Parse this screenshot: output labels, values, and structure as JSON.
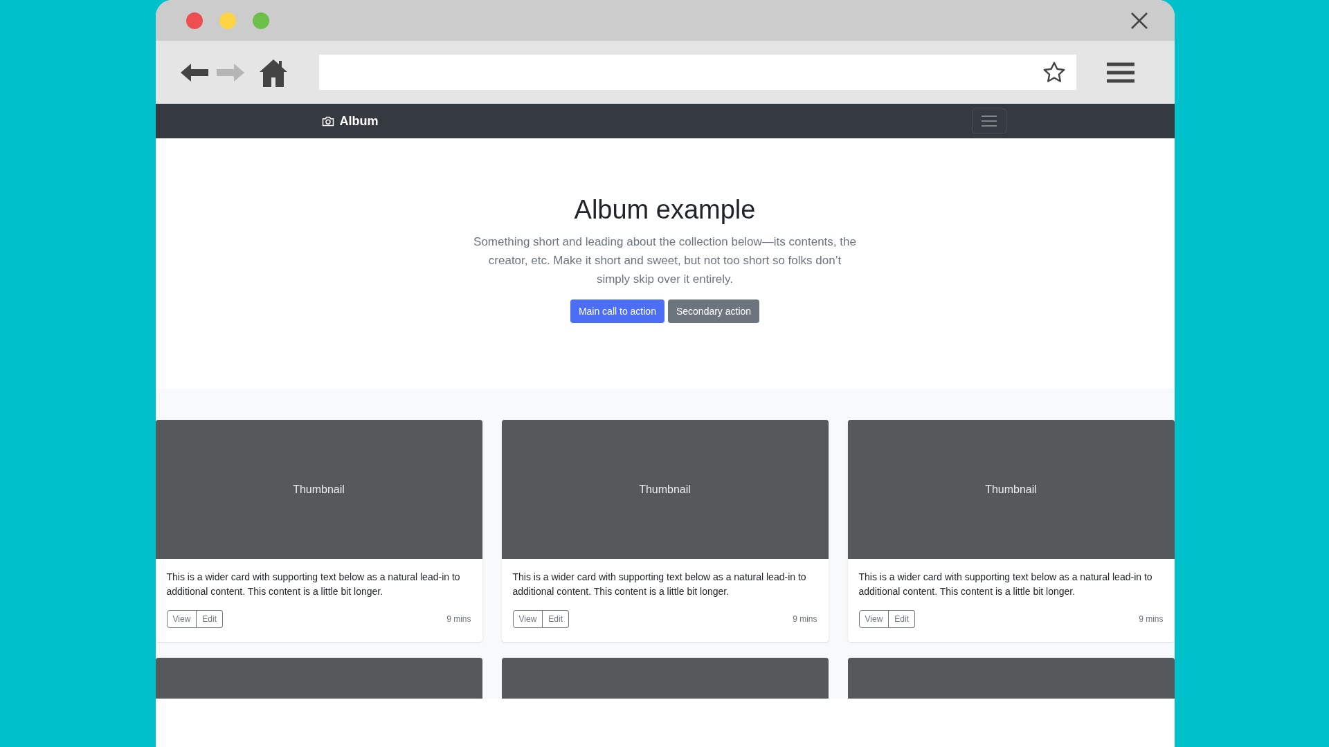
{
  "window": {
    "controls": [
      {
        "color": "#ed4e50"
      },
      {
        "color": "#fdd444"
      },
      {
        "color": "#6cc04a"
      }
    ]
  },
  "toolbar": {
    "back_enabled": true,
    "forward_enabled": false
  },
  "navbar": {
    "brand": "Album"
  },
  "hero": {
    "title": "Album example",
    "lead": "Something short and leading about the collection below—its contents, the creator, etc. Make it short and sweet, but not too short so folks don’t simply skip over it entirely.",
    "buttons": [
      {
        "label": "Main call to action",
        "kind": "primary"
      },
      {
        "label": "Secondary action",
        "kind": "secondary"
      }
    ]
  },
  "cards": [
    {
      "kind": "full",
      "thumbnail": "Thumbnail",
      "text": "This is a wider card with supporting text below as a natural lead-in to additional content. This content is a little bit longer.",
      "buttons": [
        "View",
        "Edit"
      ],
      "time": "9 mins"
    },
    {
      "kind": "full",
      "thumbnail": "Thumbnail",
      "text": "This is a wider card with supporting text below as a natural lead-in to additional content. This content is a little bit longer.",
      "buttons": [
        "View",
        "Edit"
      ],
      "time": "9 mins"
    },
    {
      "kind": "full",
      "thumbnail": "Thumbnail",
      "text": "This is a wider card with supporting text below as a natural lead-in to additional content. This content is a little bit longer.",
      "buttons": [
        "View",
        "Edit"
      ],
      "time": "9 mins"
    },
    {
      "kind": "cut"
    },
    {
      "kind": "cut"
    },
    {
      "kind": "cut"
    }
  ]
}
